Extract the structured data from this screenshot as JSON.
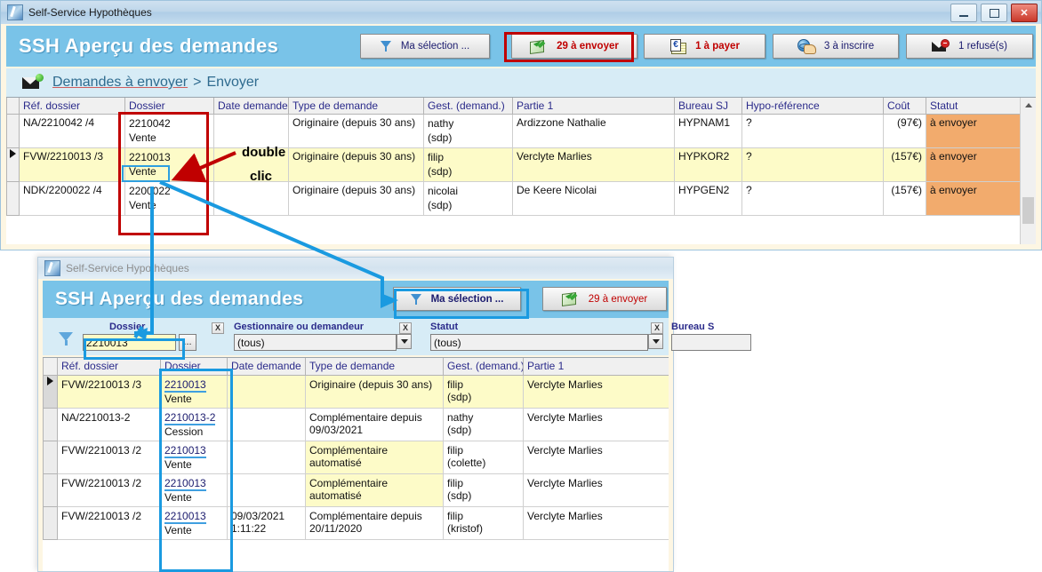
{
  "main_window": {
    "title": "Self-Service Hypothèques",
    "app_name": "SSH",
    "header_title": "SSH  Aperçu des demandes",
    "window_controls": {
      "minimize": "–",
      "maximize": "□",
      "close": "✕"
    },
    "toolbar_buttons": [
      {
        "id": "ma-selection",
        "label": "Ma sélection ...",
        "icon": "filter-funnel-icon",
        "color": "#1b1b6e"
      },
      {
        "id": "a-envoyer",
        "label": "29 à envoyer",
        "icon": "send-green-icon",
        "color": "#c00000"
      },
      {
        "id": "a-payer",
        "label": "1 à payer",
        "icon": "euro-envelope-icon",
        "color": "#c00000"
      },
      {
        "id": "a-inscrire",
        "label": "3 à inscrire",
        "icon": "globe-hand-icon",
        "color": "#1b1b6e"
      },
      {
        "id": "refuses",
        "label": "1 refusé(s)",
        "icon": "refused-mail-icon",
        "color": "#1b1b6e"
      }
    ],
    "breadcrumb": {
      "link": "Demandes à envoyer",
      "separator": ">",
      "current": "Envoyer",
      "icon": "mail-new-icon"
    },
    "grid": {
      "columns": [
        "Réf. dossier",
        "Dossier",
        "Date demande",
        "Type de demande",
        "Gest. (demand.)",
        "Partie 1",
        "Bureau SJ",
        "Hypo-référence",
        "Coût",
        "Statut"
      ],
      "rows": [
        {
          "selected": false,
          "ref": "NA/2210042 /4",
          "dossier_num": "2210042",
          "dossier_type": "Vente",
          "date": "",
          "type": "Originaire (depuis 30 ans)",
          "gest_name": "nathy",
          "gest_sub": "(sdp)",
          "partie1": "Ardizzone Nathalie",
          "bureau": "HYPNAM1",
          "bureau_highlight": false,
          "hypo_ref": "?",
          "cout": "(97€)",
          "statut": "à envoyer"
        },
        {
          "selected": true,
          "ref": "FVW/2210013 /3",
          "dossier_num": "2210013",
          "dossier_type": "Vente",
          "date": "",
          "type": "Originaire (depuis 30 ans)",
          "gest_name": "filip",
          "gest_sub": "(sdp)",
          "partie1": "Verclyte Marlies",
          "bureau": "HYPKOR2",
          "bureau_highlight": true,
          "hypo_ref": "?",
          "cout": "(157€)",
          "statut": "à envoyer"
        },
        {
          "selected": false,
          "ref": "NDK/2200022 /4",
          "dossier_num": "2200022",
          "dossier_type": "Vente",
          "date": "",
          "type": "Originaire (depuis 30 ans)",
          "gest_name": "nicolai",
          "gest_sub": "(sdp)",
          "partie1": "De Keere Nicolai",
          "bureau": "HYPGEN2",
          "bureau_highlight": true,
          "hypo_ref": "?",
          "cout": "(157€)",
          "statut": "à envoyer"
        }
      ]
    }
  },
  "sub_window": {
    "title": "Self-Service Hypothèques",
    "header_title": "SSH  Aperçu des demandes",
    "toolbar_buttons": [
      {
        "id": "ma-selection",
        "label": "Ma sélection ...",
        "icon": "filter-funnel-icon",
        "color": "#1b1b6e"
      },
      {
        "id": "a-envoyer",
        "label": "29 à envoyer",
        "icon": "send-green-icon",
        "color": "#c00000"
      }
    ],
    "filters": [
      {
        "id": "dossier",
        "label": "Dossier",
        "value": "2210013",
        "kind": "text",
        "clear": "X",
        "button": "..."
      },
      {
        "id": "gestionnaire",
        "label": "Gestionnaire ou demandeur",
        "value": "(tous)",
        "kind": "combo",
        "clear": "X"
      },
      {
        "id": "statut",
        "label": "Statut",
        "value": "(tous)",
        "kind": "combo",
        "clear": "X"
      },
      {
        "id": "bureau",
        "label": "Bureau S",
        "value": "",
        "kind": "text"
      }
    ],
    "grid": {
      "columns": [
        "Réf. dossier",
        "Dossier",
        "Date demande",
        "Type de demande",
        "Gest. (demand.)",
        "Partie 1"
      ],
      "rows": [
        {
          "selected": true,
          "ref": "FVW/2210013 /3",
          "dossier_num": "2210013",
          "dossier_type": "Vente",
          "date": "",
          "type": "Originaire (depuis 30 ans)",
          "type_highlight": false,
          "gest_name": "filip",
          "gest_sub": "(sdp)",
          "partie1": "Verclyte Marlies"
        },
        {
          "selected": false,
          "ref": "NA/2210013-2",
          "dossier_num": "2210013-2",
          "dossier_type": "Cession",
          "date": "",
          "type": "Complémentaire depuis 09/03/2021",
          "type_highlight": false,
          "gest_name": "nathy",
          "gest_sub": "(sdp)",
          "partie1": "Verclyte Marlies"
        },
        {
          "selected": false,
          "ref": "FVW/2210013 /2",
          "dossier_num": "2210013",
          "dossier_type": "Vente",
          "date": "",
          "type": "Complémentaire automatisé",
          "type_highlight": true,
          "gest_name": "filip",
          "gest_sub": "(colette)",
          "partie1": "Verclyte Marlies"
        },
        {
          "selected": false,
          "ref": "FVW/2210013 /2",
          "dossier_num": "2210013",
          "dossier_type": "Vente",
          "date": "",
          "type": "Complémentaire automatisé",
          "type_highlight": true,
          "gest_name": "filip",
          "gest_sub": "(sdp)",
          "partie1": "Verclyte Marlies"
        },
        {
          "selected": false,
          "ref": "FVW/2210013 /2",
          "dossier_num": "2210013",
          "dossier_type": "Vente",
          "date": "09/03/2021 1:11:22",
          "type": "Complémentaire depuis 20/11/2020",
          "type_highlight": false,
          "gest_name": "filip",
          "gest_sub": "(kristof)",
          "partie1": "Verclyte Marlies"
        }
      ]
    }
  },
  "annotations": {
    "double": "double",
    "clic": "clic",
    "red_color": "#c00000",
    "blue_color": "#1a9ae0"
  }
}
